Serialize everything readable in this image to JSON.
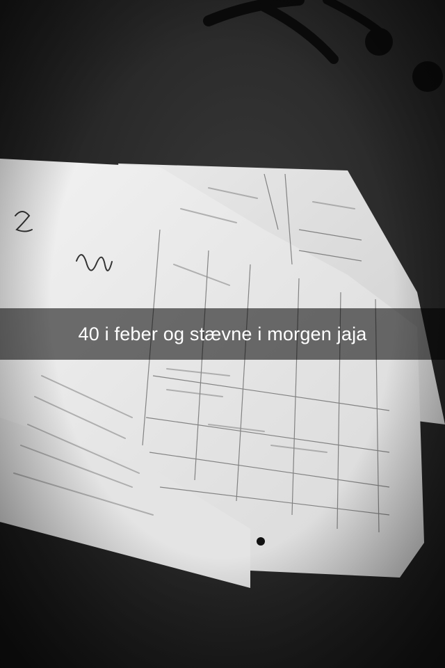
{
  "snap": {
    "caption": "40 i feber og stævne i morgen jaja"
  },
  "photo": {
    "subject": "papers-on-dark-surface",
    "colors": {
      "background_dark": "#1f1f1f",
      "paper": "#e8e8e8",
      "ink": "#555555"
    }
  }
}
